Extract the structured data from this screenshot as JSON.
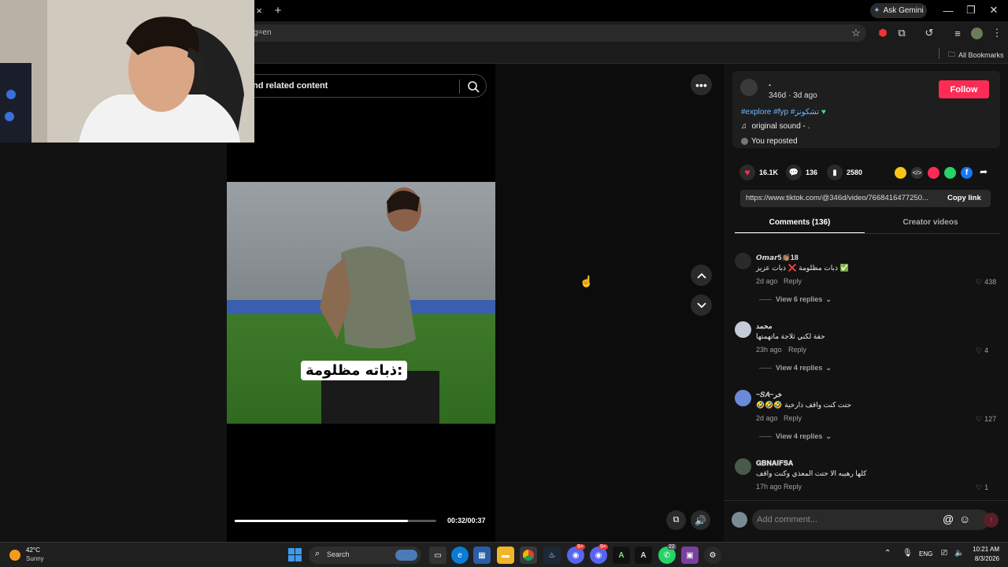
{
  "browser": {
    "new_tab_symbol": "+",
    "close_tab_symbol": "×",
    "ask_gemini": "Ask Gemini",
    "url_fragment": "g=en",
    "all_bookmarks": "All Bookmarks"
  },
  "search": {
    "placeholder_tail": "nd related content"
  },
  "video": {
    "caption": "ذباته مظلومة:",
    "time": "00:32/00:37",
    "progress": 0.86
  },
  "post": {
    "author": ".",
    "meta": "346d · 3d ago",
    "follow_label": "Follow",
    "tags": "#explore #fyp #تشكونز",
    "sound": "original sound - .",
    "reposted": "You reposted",
    "likes": "16.1K",
    "comments": "136",
    "saves": "2580",
    "link": "https://www.tiktok.com/@346d/video/7668416477250...",
    "copy_link": "Copy link",
    "tab_comments": "Comments (136)",
    "tab_creator": "Creator videos"
  },
  "comments": [
    {
      "name": "𝙊𝙢𝙖𝙧5👏🏽18",
      "text": "ذبات مظلومة ❌ ذبات عزيز ✅",
      "date": "2d ago",
      "reply": "Reply",
      "likes": "438",
      "view": "View 6 replies"
    },
    {
      "name": "محمد",
      "text": "حقة لكني ثلاجة ماتهمتها",
      "date": "23h ago",
      "reply": "Reply",
      "likes": "4",
      "view": "View 4 replies"
    },
    {
      "name": "~𝑆𝐴~خر",
      "text": "🤣🤣🤣 حتت كنت واقف ذارخية",
      "date": "2d ago",
      "reply": "Reply",
      "likes": "127",
      "view": "View 4 replies"
    },
    {
      "name": "𝐆𝐁𝐍𝐀𝐈𝐅𝐒𝐀",
      "text": "كلها رهيبه الا حتت المعذي وكنت واقف",
      "date": "17h ago",
      "reply": "Reply",
      "likes": "1",
      "view": ""
    }
  ],
  "composer": {
    "placeholder": "Add comment..."
  },
  "taskbar": {
    "temp": "42°C",
    "weather": "Sunny",
    "search_label": "Search",
    "lang": "ENG",
    "time": "10:21 AM",
    "date": "8/3/2026",
    "badge_discord": "9+",
    "badge_discord2": "9+",
    "badge_whatsapp": "22"
  },
  "colors": {
    "follow": "#fe2c55",
    "accent_link": "#6cb8ff",
    "like_heart": "#fe2c55"
  }
}
